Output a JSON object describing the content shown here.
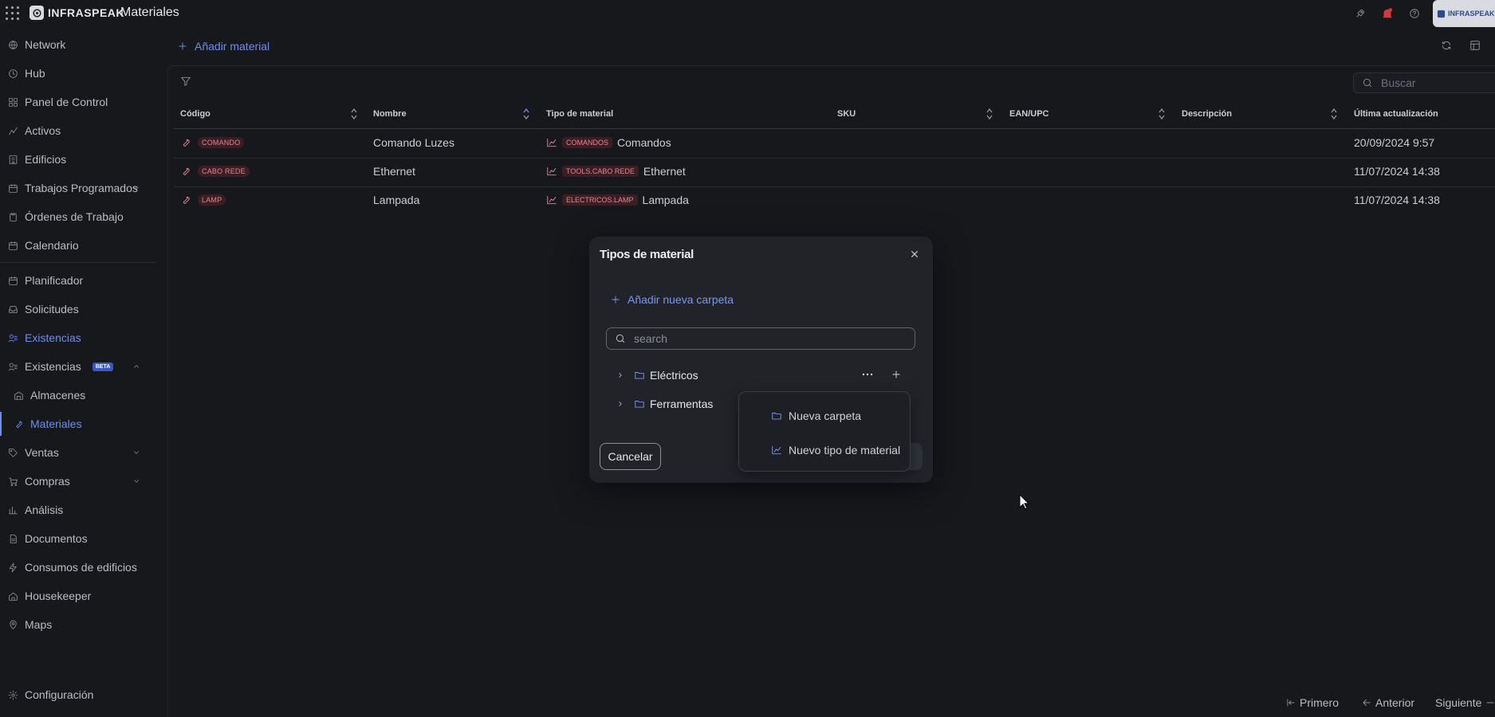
{
  "app": {
    "brand": "INFRASPEAK",
    "page_title": "Materiales",
    "account_brand": "INFRASPEAK"
  },
  "sidebar": {
    "items": [
      {
        "label": "Network",
        "icon": "globe-icon"
      },
      {
        "label": "Hub",
        "icon": "clock-icon"
      },
      {
        "label": "Panel de Control",
        "icon": "dashboard-icon"
      },
      {
        "label": "Activos",
        "icon": "activity-icon"
      },
      {
        "label": "Edificios",
        "icon": "building-icon"
      },
      {
        "label": "Trabajos Programados",
        "icon": "calendar-check-icon"
      },
      {
        "label": "Órdenes de Trabajo",
        "icon": "clipboard-icon"
      },
      {
        "label": "Calendario",
        "icon": "calendar-icon"
      },
      {
        "label": "Planificador",
        "icon": "calendar-icon"
      },
      {
        "label": "Solicitudes",
        "icon": "inbox-icon"
      },
      {
        "label": "Existencias",
        "icon": "stock-icon"
      },
      {
        "label": "Existencias",
        "icon": "stock-icon",
        "badge": "BETA"
      },
      {
        "label": "Almacenes",
        "icon": "warehouse-icon"
      },
      {
        "label": "Materiales",
        "icon": "wrench-icon"
      },
      {
        "label": "Ventas",
        "icon": "tag-icon"
      },
      {
        "label": "Compras",
        "icon": "cart-icon"
      },
      {
        "label": "Análisis",
        "icon": "bar-chart-icon"
      },
      {
        "label": "Documentos",
        "icon": "document-icon"
      },
      {
        "label": "Consumos de edificios",
        "icon": "bolt-icon"
      },
      {
        "label": "Housekeeper",
        "icon": "home-icon"
      },
      {
        "label": "Maps",
        "icon": "map-pin-icon"
      },
      {
        "label": "Configuración",
        "icon": "gear-icon"
      }
    ]
  },
  "toolbar": {
    "add_material": "Añadir material",
    "search_placeholder": "Buscar"
  },
  "table": {
    "columns": [
      "Código",
      "Nombre",
      "Tipo de material",
      "SKU",
      "EAN/UPC",
      "Descripción",
      "Última actualización"
    ],
    "rows": [
      {
        "code": "COMANDO",
        "name": "Comando Luzes",
        "type_tag": "COMANDOS",
        "type_name": "Comandos",
        "sku": "",
        "ean": "",
        "description": "",
        "updated": "20/09/2024 9:57"
      },
      {
        "code": "CABO REDE",
        "name": "Ethernet",
        "type_tag": "TOOLS.CABO REDE",
        "type_name": "Ethernet",
        "sku": "",
        "ean": "",
        "description": "",
        "updated": "11/07/2024 14:38"
      },
      {
        "code": "LAMP",
        "name": "Lampada",
        "type_tag": "ELECTRICOS.LAMP",
        "type_name": "Lampada",
        "sku": "",
        "ean": "",
        "description": "",
        "updated": "11/07/2024 14:38"
      }
    ]
  },
  "modal": {
    "title": "Tipos de material",
    "add_folder": "Añadir nueva carpeta",
    "search_placeholder": "search",
    "tree": [
      {
        "label": "Eléctricos"
      },
      {
        "label": "Ferramentas"
      }
    ],
    "cancel": "Cancelar",
    "dropdown": {
      "new_folder": "Nueva carpeta",
      "new_type": "Nuevo tipo de material"
    }
  },
  "pagination": {
    "first": "Primero",
    "previous": "Anterior",
    "next": "Siguiente"
  },
  "colors": {
    "accent": "#6f8df0",
    "tag_bg": "#3a1e24",
    "tag_text": "#e38690",
    "background": "#17181c"
  }
}
